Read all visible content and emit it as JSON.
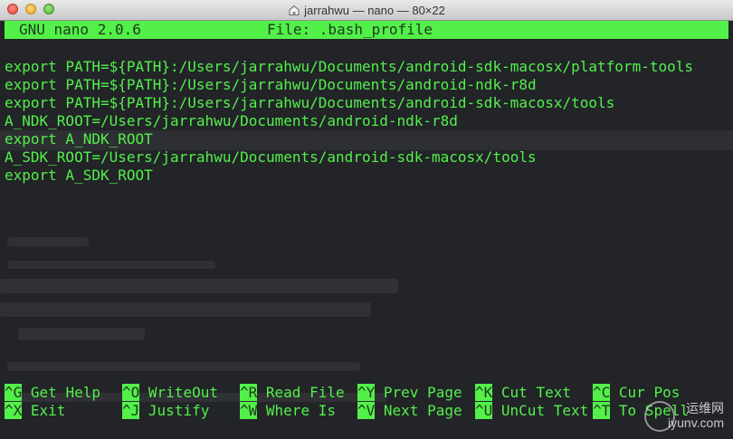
{
  "window": {
    "title": "jarrahwu — nano — 80×22"
  },
  "nano": {
    "version": "GNU nano 2.0.6",
    "file_label": "File: .bash_profile"
  },
  "content": {
    "lines": [
      "export PATH=${PATH}:/Users/jarrahwu/Documents/android-sdk-macosx/platform-tools",
      "export PATH=${PATH}:/Users/jarrahwu/Documents/android-ndk-r8d",
      "export PATH=${PATH}:/Users/jarrahwu/Documents/android-sdk-macosx/tools",
      "A_NDK_ROOT=/Users/jarrahwu/Documents/android-ndk-r8d",
      "export A_NDK_ROOT",
      "A_SDK_ROOT=/Users/jarrahwu/Documents/android-sdk-macosx/tools",
      "export A_SDK_ROOT"
    ]
  },
  "shortcuts": {
    "row1": [
      {
        "key": "^G",
        "label": "Get Help"
      },
      {
        "key": "^O",
        "label": "WriteOut"
      },
      {
        "key": "^R",
        "label": "Read File"
      },
      {
        "key": "^Y",
        "label": "Prev Page"
      },
      {
        "key": "^K",
        "label": "Cut Text"
      },
      {
        "key": "^C",
        "label": "Cur Pos"
      }
    ],
    "row2": [
      {
        "key": "^X",
        "label": "Exit"
      },
      {
        "key": "^J",
        "label": "Justify"
      },
      {
        "key": "^W",
        "label": "Where Is"
      },
      {
        "key": "^V",
        "label": "Next Page"
      },
      {
        "key": "^U",
        "label": "UnCut Text"
      },
      {
        "key": "^T",
        "label": "To Spell"
      }
    ]
  },
  "watermark": {
    "line1": "运维网",
    "line2": "iyunv.com"
  },
  "colors": {
    "terminal_green": "#53f04a",
    "background": "#222428"
  }
}
